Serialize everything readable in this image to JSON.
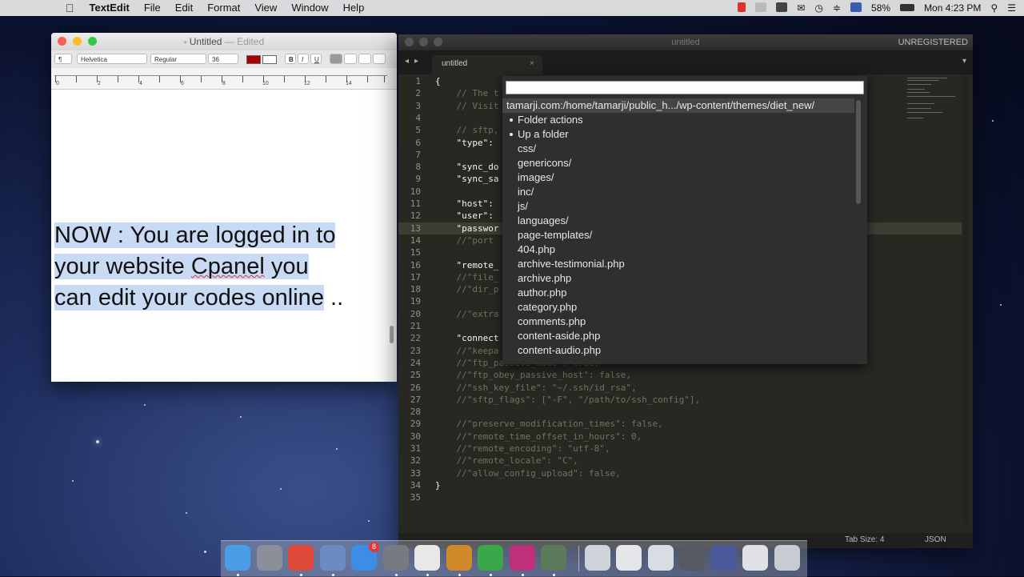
{
  "menubar": {
    "app": "TextEdit",
    "items": [
      "File",
      "Edit",
      "Format",
      "View",
      "Window",
      "Help"
    ],
    "battery": "58%",
    "clock": "Mon 4:23 PM"
  },
  "textedit": {
    "title": "Untitled",
    "title_suffix": "— Edited",
    "font_family": "Helvetica",
    "font_style": "Regular",
    "font_size": "36",
    "paragraph_style": "¶",
    "bold": "B",
    "italic": "I",
    "underline": "U",
    "ruler_numbers": [
      "0",
      "2",
      "4",
      "6",
      "8",
      "10",
      "12",
      "14"
    ],
    "body_line1": "NOW : You are logged in to",
    "body_line2a": "your website ",
    "body_line2b": "Cpanel",
    "body_line2c": " you",
    "body_line3": "can edit your codes online",
    "body_tail": " .."
  },
  "sublime": {
    "title": "untitled",
    "unregistered": "UNREGISTERED",
    "tab": "untitled",
    "tab_close": "×",
    "status_tab_size": "Tab Size: 4",
    "status_syntax": "JSON",
    "lines": [
      {
        "n": "1",
        "t": "{",
        "c": false
      },
      {
        "n": "2",
        "t": "    // The t",
        "c": true
      },
      {
        "n": "3",
        "t": "    // Visit",
        "c": true
      },
      {
        "n": "4",
        "t": "",
        "c": false
      },
      {
        "n": "5",
        "t": "    // sftp,",
        "c": true
      },
      {
        "n": "6",
        "t": "    \"type\":",
        "c": false
      },
      {
        "n": "7",
        "t": "",
        "c": false
      },
      {
        "n": "8",
        "t": "    \"sync_do",
        "c": false
      },
      {
        "n": "9",
        "t": "    \"sync_sa",
        "c": false
      },
      {
        "n": "10",
        "t": "",
        "c": false
      },
      {
        "n": "11",
        "t": "    \"host\":",
        "c": false
      },
      {
        "n": "12",
        "t": "    \"user\":",
        "c": false
      },
      {
        "n": "13",
        "t": "    \"passwor",
        "c": false
      },
      {
        "n": "14",
        "t": "    //\"port",
        "c": true
      },
      {
        "n": "15",
        "t": "",
        "c": false
      },
      {
        "n": "16",
        "t": "    \"remote_",
        "c": false
      },
      {
        "n": "17",
        "t": "    //\"file_",
        "c": true
      },
      {
        "n": "18",
        "t": "    //\"dir_p",
        "c": true
      },
      {
        "n": "19",
        "t": "",
        "c": false
      },
      {
        "n": "20",
        "t": "    //\"extra",
        "c": true
      },
      {
        "n": "21",
        "t": "",
        "c": false
      },
      {
        "n": "22",
        "t": "    \"connect",
        "c": false
      },
      {
        "n": "23",
        "t": "    //\"keepa",
        "c": true
      },
      {
        "n": "24",
        "t": "    //\"ftp_passive_mode\": true,",
        "c": true
      },
      {
        "n": "25",
        "t": "    //\"ftp_obey_passive_host\": false,",
        "c": true
      },
      {
        "n": "26",
        "t": "    //\"ssh_key_file\": \"~/.ssh/id_rsa\",",
        "c": true
      },
      {
        "n": "27",
        "t": "    //\"sftp_flags\": [\"-F\", \"/path/to/ssh_config\"],",
        "c": true
      },
      {
        "n": "28",
        "t": "",
        "c": false
      },
      {
        "n": "29",
        "t": "    //\"preserve_modification_times\": false,",
        "c": true
      },
      {
        "n": "30",
        "t": "    //\"remote_time_offset_in_hours\": 0,",
        "c": true
      },
      {
        "n": "31",
        "t": "    //\"remote_encoding\": \"utf-8\",",
        "c": true
      },
      {
        "n": "32",
        "t": "    //\"remote_locale\": \"C\",",
        "c": true
      },
      {
        "n": "33",
        "t": "    //\"allow_config_upload\": false,",
        "c": true
      },
      {
        "n": "34",
        "t": "}",
        "c": false
      },
      {
        "n": "35",
        "t": "",
        "c": false
      }
    ]
  },
  "quick_panel": {
    "input_value": "",
    "items": [
      {
        "label": "tamarji.com:/home/tamarji/public_h.../wp-content/themes/diet_new/",
        "selected": true,
        "bullet": false
      },
      {
        "label": "Folder actions",
        "selected": false,
        "bullet": true
      },
      {
        "label": "Up a folder",
        "selected": false,
        "bullet": true
      },
      {
        "label": "css/",
        "selected": false,
        "bullet": false
      },
      {
        "label": "genericons/",
        "selected": false,
        "bullet": false
      },
      {
        "label": "images/",
        "selected": false,
        "bullet": false
      },
      {
        "label": "inc/",
        "selected": false,
        "bullet": false
      },
      {
        "label": "js/",
        "selected": false,
        "bullet": false
      },
      {
        "label": "languages/",
        "selected": false,
        "bullet": false
      },
      {
        "label": "page-templates/",
        "selected": false,
        "bullet": false
      },
      {
        "label": "404.php",
        "selected": false,
        "bullet": false
      },
      {
        "label": "archive-testimonial.php",
        "selected": false,
        "bullet": false
      },
      {
        "label": "archive.php",
        "selected": false,
        "bullet": false
      },
      {
        "label": "author.php",
        "selected": false,
        "bullet": false
      },
      {
        "label": "category.php",
        "selected": false,
        "bullet": false
      },
      {
        "label": "comments.php",
        "selected": false,
        "bullet": false
      },
      {
        "label": "content-aside.php",
        "selected": false,
        "bullet": false
      },
      {
        "label": "content-audio.php",
        "selected": false,
        "bullet": false
      }
    ]
  },
  "dock": {
    "badge": "8",
    "apps": [
      {
        "name": "finder-icon",
        "color": "#4a9ee8"
      },
      {
        "name": "launchpad-icon",
        "color": "#8a8f9a"
      },
      {
        "name": "chrome-icon",
        "color": "#e04a3a"
      },
      {
        "name": "preview-icon",
        "color": "#6a8cc0"
      },
      {
        "name": "app-store-icon",
        "color": "#3a8ee6"
      },
      {
        "name": "system-preferences-icon",
        "color": "#777a80"
      },
      {
        "name": "textedit-icon",
        "color": "#e8e8e8"
      },
      {
        "name": "sublime-text-icon",
        "color": "#d08a2a"
      },
      {
        "name": "green-app-icon",
        "color": "#3aa84a"
      },
      {
        "name": "pink-app-icon",
        "color": "#c0307a"
      },
      {
        "name": "photo-app-icon",
        "color": "#5a7a5a"
      },
      {
        "name": "window-thumb-1-icon",
        "color": "#cfd4da"
      },
      {
        "name": "window-thumb-2-icon",
        "color": "#e4e6ea"
      },
      {
        "name": "window-thumb-3-icon",
        "color": "#d8dde4"
      },
      {
        "name": "window-thumb-4-icon",
        "color": "#555a62"
      },
      {
        "name": "window-thumb-5-icon",
        "color": "#4a5a9a"
      },
      {
        "name": "window-thumb-6-icon",
        "color": "#e0e2e6"
      },
      {
        "name": "trash-icon",
        "color": "#c8ccd2"
      }
    ]
  }
}
